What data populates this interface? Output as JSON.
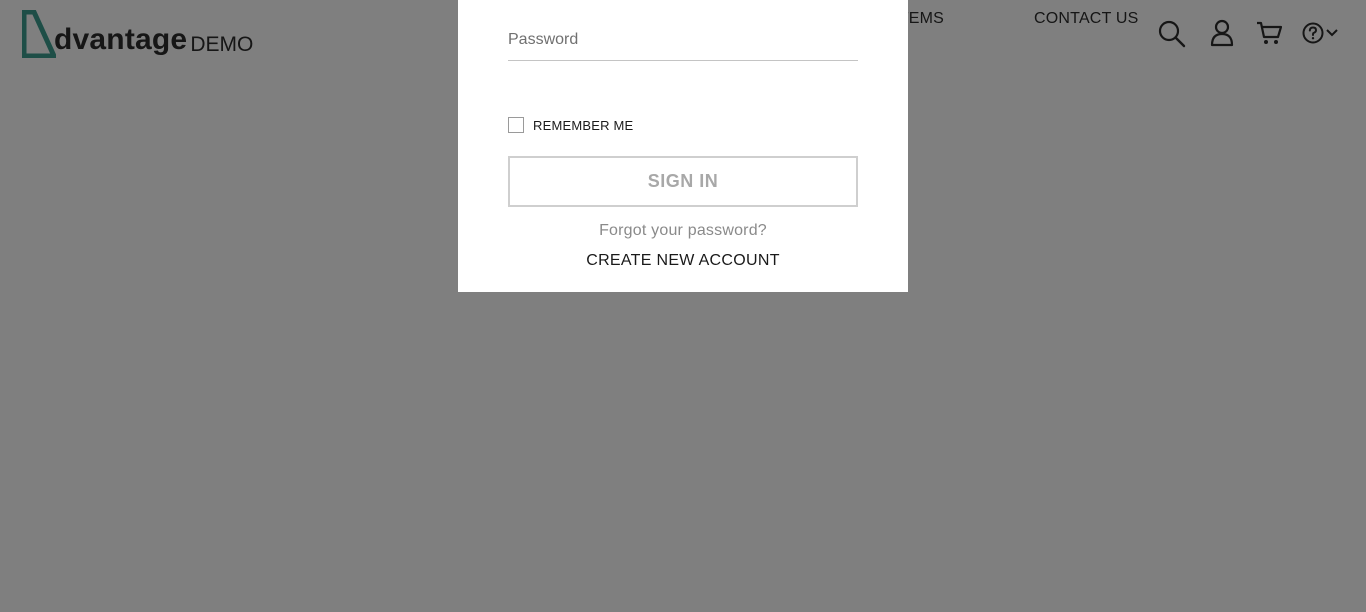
{
  "header": {
    "logo_word": "dvantage",
    "logo_suffix": "DEMO",
    "nav": {
      "popular_items": "ULAR ITEMS",
      "contact_us": "CONTACT US"
    },
    "icons": [
      "search-icon",
      "user-icon",
      "cart-icon",
      "help-icon",
      "chevron-down-icon"
    ]
  },
  "login": {
    "password_placeholder": "Password",
    "password_value": "",
    "remember_me_label": "REMEMBER ME",
    "remember_me_checked": false,
    "sign_in_label": "SIGN IN",
    "forgot_password": "Forgot your password?",
    "create_account": "CREATE NEW ACCOUNT"
  },
  "colors": {
    "brand_teal": "#3c9c8f",
    "overlay": "#7f7f7f",
    "text_dark": "#2c2c2c"
  }
}
